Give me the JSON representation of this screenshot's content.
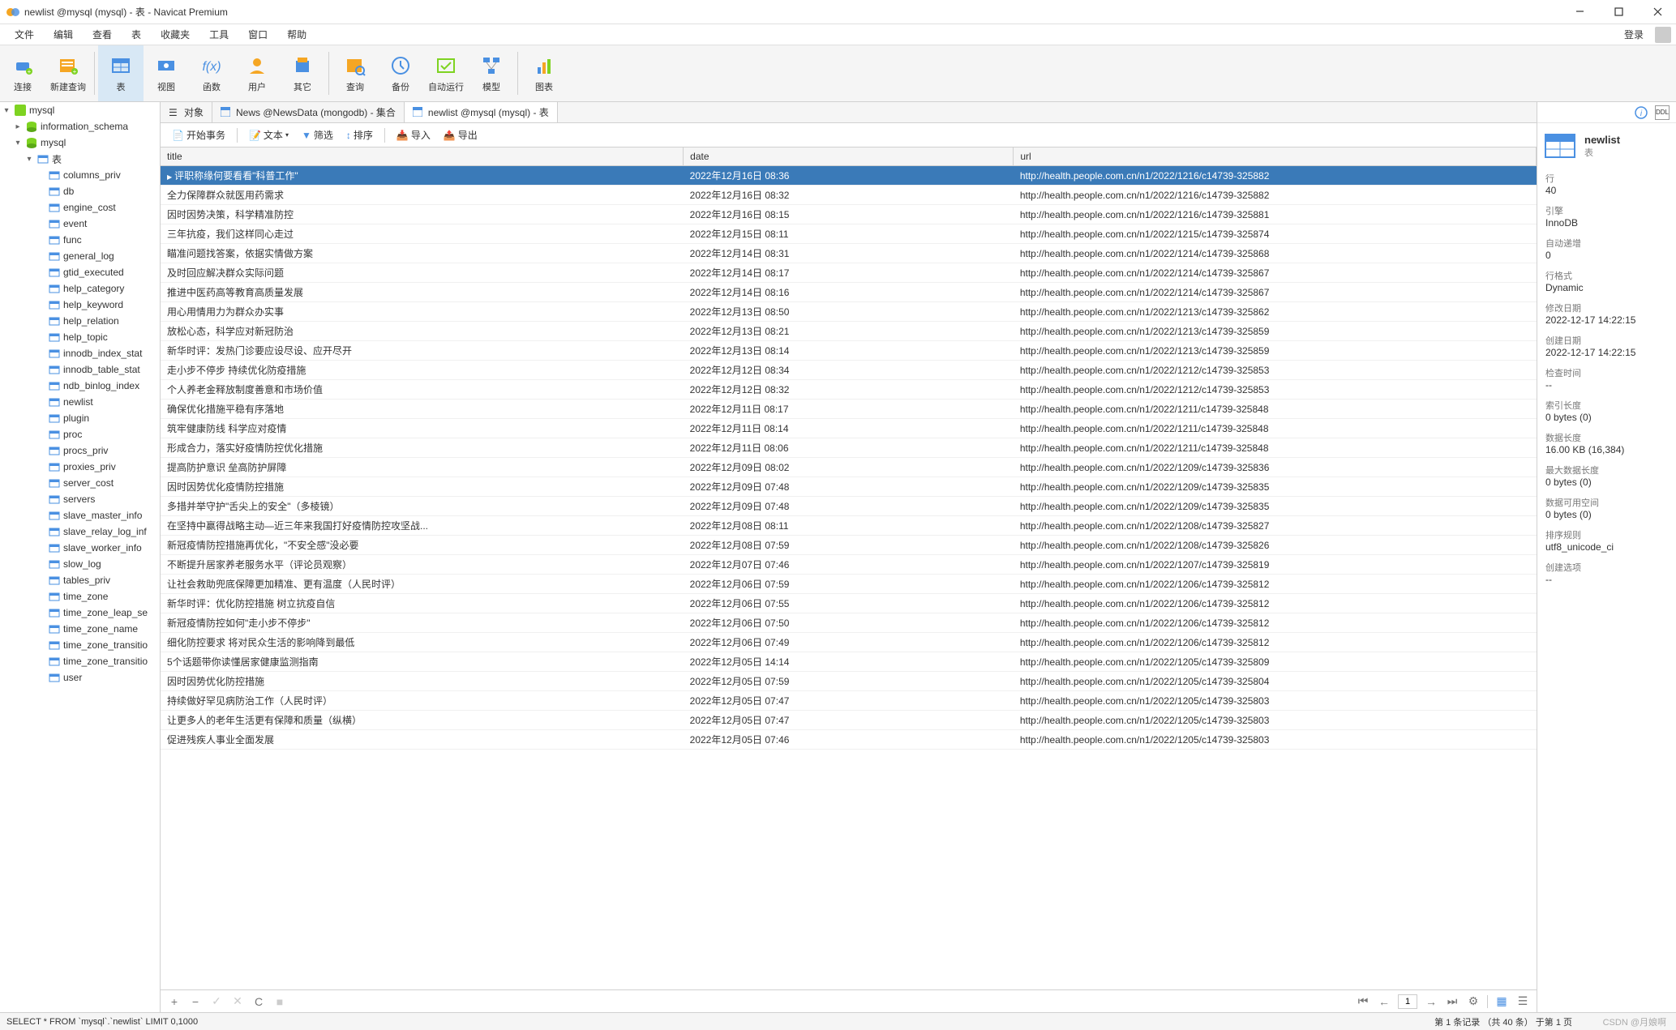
{
  "window": {
    "title": "newlist @mysql (mysql) - 表 - Navicat Premium"
  },
  "menu": {
    "file": "文件",
    "edit": "编辑",
    "view": "查看",
    "table": "表",
    "favorites": "收藏夹",
    "tools": "工具",
    "window": "窗口",
    "help": "帮助",
    "login": "登录"
  },
  "toolbar": {
    "connection": "连接",
    "new_query": "新建查询",
    "table": "表",
    "view": "视图",
    "func": "函数",
    "user": "用户",
    "other": "其它",
    "query": "查询",
    "backup": "备份",
    "auto_run": "自动运行",
    "model": "模型",
    "chart": "图表"
  },
  "tree": {
    "root": "mysql",
    "db1": "information_schema",
    "db2": "mysql",
    "tables_label": "表",
    "leaves": [
      "columns_priv",
      "db",
      "engine_cost",
      "event",
      "func",
      "general_log",
      "gtid_executed",
      "help_category",
      "help_keyword",
      "help_relation",
      "help_topic",
      "innodb_index_stat",
      "innodb_table_stat",
      "ndb_binlog_index",
      "newlist",
      "plugin",
      "proc",
      "procs_priv",
      "proxies_priv",
      "server_cost",
      "servers",
      "slave_master_info",
      "slave_relay_log_inf",
      "slave_worker_info",
      "slow_log",
      "tables_priv",
      "time_zone",
      "time_zone_leap_se",
      "time_zone_name",
      "time_zone_transitio",
      "time_zone_transitio",
      "user"
    ]
  },
  "tabs": {
    "t0": "对象",
    "t1": "News @NewsData (mongodb) - 集合",
    "t2": "newlist @mysql (mysql) - 表"
  },
  "subtoolbar": {
    "begin_txn": "开始事务",
    "text": "文本",
    "filter": "筛选",
    "sort": "排序",
    "import": "导入",
    "export": "导出"
  },
  "grid": {
    "columns": {
      "title": "title",
      "date": "date",
      "url": "url"
    },
    "rows": [
      {
        "title": "评职称缘何要看看\"科普工作\"",
        "date": "2022年12月16日 08:36",
        "url": "http://health.people.com.cn/n1/2022/1216/c14739-325882"
      },
      {
        "title": "全力保障群众就医用药需求",
        "date": "2022年12月16日 08:32",
        "url": "http://health.people.com.cn/n1/2022/1216/c14739-325882"
      },
      {
        "title": "因时因势决策，科学精准防控",
        "date": "2022年12月16日 08:15",
        "url": "http://health.people.com.cn/n1/2022/1216/c14739-325881"
      },
      {
        "title": "三年抗疫，我们这样同心走过",
        "date": "2022年12月15日 08:11",
        "url": "http://health.people.com.cn/n1/2022/1215/c14739-325874"
      },
      {
        "title": "瞄准问题找答案，依据实情做方案",
        "date": "2022年12月14日 08:31",
        "url": "http://health.people.com.cn/n1/2022/1214/c14739-325868"
      },
      {
        "title": "及时回应解决群众实际问题",
        "date": "2022年12月14日 08:17",
        "url": "http://health.people.com.cn/n1/2022/1214/c14739-325867"
      },
      {
        "title": "推进中医药高等教育高质量发展",
        "date": "2022年12月14日 08:16",
        "url": "http://health.people.com.cn/n1/2022/1214/c14739-325867"
      },
      {
        "title": "用心用情用力为群众办实事",
        "date": "2022年12月13日 08:50",
        "url": "http://health.people.com.cn/n1/2022/1213/c14739-325862"
      },
      {
        "title": "放松心态，科学应对新冠防治",
        "date": "2022年12月13日 08:21",
        "url": "http://health.people.com.cn/n1/2022/1213/c14739-325859"
      },
      {
        "title": "新华时评：发热门诊要应设尽设、应开尽开",
        "date": "2022年12月13日 08:14",
        "url": "http://health.people.com.cn/n1/2022/1213/c14739-325859"
      },
      {
        "title": "走小步不停步 持续优化防疫措施",
        "date": "2022年12月12日 08:34",
        "url": "http://health.people.com.cn/n1/2022/1212/c14739-325853"
      },
      {
        "title": "个人养老金释放制度善意和市场价值",
        "date": "2022年12月12日 08:32",
        "url": "http://health.people.com.cn/n1/2022/1212/c14739-325853"
      },
      {
        "title": "确保优化措施平稳有序落地",
        "date": "2022年12月11日 08:17",
        "url": "http://health.people.com.cn/n1/2022/1211/c14739-325848"
      },
      {
        "title": "筑牢健康防线 科学应对疫情",
        "date": "2022年12月11日 08:14",
        "url": "http://health.people.com.cn/n1/2022/1211/c14739-325848"
      },
      {
        "title": "形成合力，落实好疫情防控优化措施",
        "date": "2022年12月11日 08:06",
        "url": "http://health.people.com.cn/n1/2022/1211/c14739-325848"
      },
      {
        "title": "提高防护意识 垒高防护屏障",
        "date": "2022年12月09日 08:02",
        "url": "http://health.people.com.cn/n1/2022/1209/c14739-325836"
      },
      {
        "title": "因时因势优化疫情防控措施",
        "date": "2022年12月09日 07:48",
        "url": "http://health.people.com.cn/n1/2022/1209/c14739-325835"
      },
      {
        "title": "多措并举守护\"舌尖上的安全\"（多棱镜）",
        "date": "2022年12月09日 07:48",
        "url": "http://health.people.com.cn/n1/2022/1209/c14739-325835"
      },
      {
        "title": "在坚持中赢得战略主动—近三年来我国打好疫情防控攻坚战...",
        "date": "2022年12月08日 08:11",
        "url": "http://health.people.com.cn/n1/2022/1208/c14739-325827"
      },
      {
        "title": "新冠疫情防控措施再优化，\"不安全感\"没必要",
        "date": "2022年12月08日 07:59",
        "url": "http://health.people.com.cn/n1/2022/1208/c14739-325826"
      },
      {
        "title": "不断提升居家养老服务水平（评论员观察）",
        "date": "2022年12月07日 07:46",
        "url": "http://health.people.com.cn/n1/2022/1207/c14739-325819"
      },
      {
        "title": "让社会救助兜底保障更加精准、更有温度（人民时评）",
        "date": "2022年12月06日 07:59",
        "url": "http://health.people.com.cn/n1/2022/1206/c14739-325812"
      },
      {
        "title": "新华时评：优化防控措施 树立抗疫自信",
        "date": "2022年12月06日 07:55",
        "url": "http://health.people.com.cn/n1/2022/1206/c14739-325812"
      },
      {
        "title": "新冠疫情防控如何\"走小步不停步\"",
        "date": "2022年12月06日 07:50",
        "url": "http://health.people.com.cn/n1/2022/1206/c14739-325812"
      },
      {
        "title": "细化防控要求 将对民众生活的影响降到最低",
        "date": "2022年12月06日 07:49",
        "url": "http://health.people.com.cn/n1/2022/1206/c14739-325812"
      },
      {
        "title": "5个话题带你读懂居家健康监测指南",
        "date": "2022年12月05日 14:14",
        "url": "http://health.people.com.cn/n1/2022/1205/c14739-325809"
      },
      {
        "title": "因时因势优化防控措施",
        "date": "2022年12月05日 07:59",
        "url": "http://health.people.com.cn/n1/2022/1205/c14739-325804"
      },
      {
        "title": "持续做好罕见病防治工作（人民时评）",
        "date": "2022年12月05日 07:47",
        "url": "http://health.people.com.cn/n1/2022/1205/c14739-325803"
      },
      {
        "title": "让更多人的老年生活更有保障和质量（纵横）",
        "date": "2022年12月05日 07:47",
        "url": "http://health.people.com.cn/n1/2022/1205/c14739-325803"
      },
      {
        "title": "促进残疾人事业全面发展",
        "date": "2022年12月05日 07:46",
        "url": "http://health.people.com.cn/n1/2022/1205/c14739-325803"
      }
    ]
  },
  "footer": {
    "page": "1",
    "add": "+",
    "remove": "−",
    "confirm": "✓",
    "cancel": "✕",
    "refresh": "C",
    "stop": "■"
  },
  "rightpanel": {
    "name": "newlist",
    "type": "表",
    "props": [
      {
        "label": "行",
        "value": "40"
      },
      {
        "label": "引擎",
        "value": "InnoDB"
      },
      {
        "label": "自动递增",
        "value": "0"
      },
      {
        "label": "行格式",
        "value": "Dynamic"
      },
      {
        "label": "修改日期",
        "value": "2022-12-17 14:22:15"
      },
      {
        "label": "创建日期",
        "value": "2022-12-17 14:22:15"
      },
      {
        "label": "检查时间",
        "value": "--"
      },
      {
        "label": "索引长度",
        "value": "0 bytes (0)"
      },
      {
        "label": "数据长度",
        "value": "16.00 KB (16,384)"
      },
      {
        "label": "最大数据长度",
        "value": "0 bytes (0)"
      },
      {
        "label": "数据可用空间",
        "value": "0 bytes (0)"
      },
      {
        "label": "排序规则",
        "value": "utf8_unicode_ci"
      },
      {
        "label": "创建选项",
        "value": "--"
      }
    ]
  },
  "statusbar": {
    "sql": "SELECT * FROM `mysql`.`newlist` LIMIT 0,1000",
    "info": "第 1 条记录 （共 40 条） 于第 1 页"
  },
  "watermark": "CSDN @月娘啊"
}
